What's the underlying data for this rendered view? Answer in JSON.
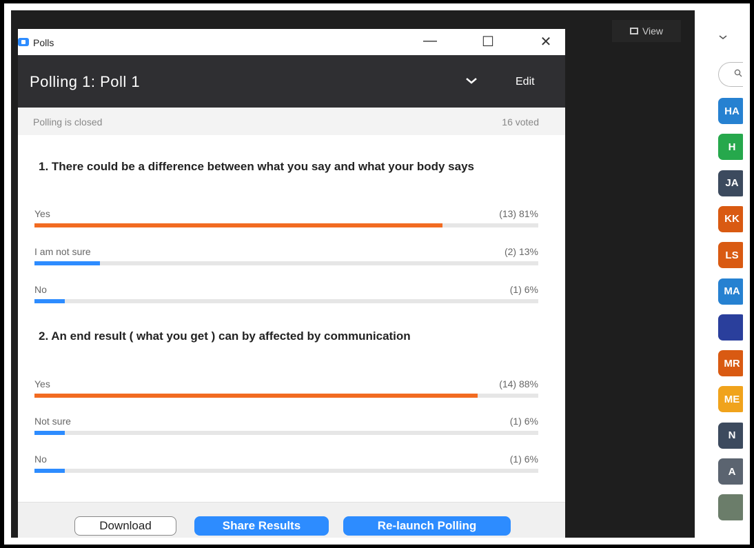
{
  "window": {
    "title": "Polls"
  },
  "header": {
    "title": "Polling 1: Poll 1",
    "edit_label": "Edit"
  },
  "status": {
    "state": "Polling is closed",
    "voted": "16 voted"
  },
  "questions": [
    {
      "text": "1. There could be a difference between what you say and what your body says",
      "answers": [
        {
          "label": "Yes",
          "count": "(13) 81%",
          "percent": 81,
          "color": "#f26b21"
        },
        {
          "label": "I am not sure",
          "count": "(2) 13%",
          "percent": 13,
          "color": "#2d8cff"
        },
        {
          "label": "No",
          "count": "(1) 6%",
          "percent": 6,
          "color": "#2d8cff"
        }
      ]
    },
    {
      "text": "2. An end result ( what you get ) can by affected by communication",
      "answers": [
        {
          "label": "Yes",
          "count": "(14) 88%",
          "percent": 88,
          "color": "#f26b21"
        },
        {
          "label": "Not sure",
          "count": "(1) 6%",
          "percent": 6,
          "color": "#2d8cff"
        },
        {
          "label": "No",
          "count": "(1) 6%",
          "percent": 6,
          "color": "#2d8cff"
        }
      ]
    }
  ],
  "footer": {
    "download_label": "Download",
    "share_label": "Share Results",
    "relaunch_label": "Re-launch Polling"
  },
  "view": {
    "label": "View"
  },
  "participants": [
    {
      "initials": "HA",
      "color": "#2681d1"
    },
    {
      "initials": "H",
      "color": "#26a84c"
    },
    {
      "initials": "JA",
      "color": "#3c4a5e"
    },
    {
      "initials": "KK",
      "color": "#d95a12"
    },
    {
      "initials": "LS",
      "color": "#d95a12"
    },
    {
      "initials": "MA",
      "color": "#2681d1"
    },
    {
      "initials": "",
      "color": "#2a3f9c"
    },
    {
      "initials": "MR",
      "color": "#d95a12"
    },
    {
      "initials": "ME",
      "color": "#f0a31c"
    },
    {
      "initials": "N",
      "color": "#3c4a5e"
    },
    {
      "initials": "A",
      "color": "#5b6470"
    },
    {
      "initials": "",
      "color": "#6b7d6a"
    }
  ],
  "colors": {
    "accent": "#2d8cff",
    "orange": "#f26b21",
    "header": "#2f2f32"
  }
}
